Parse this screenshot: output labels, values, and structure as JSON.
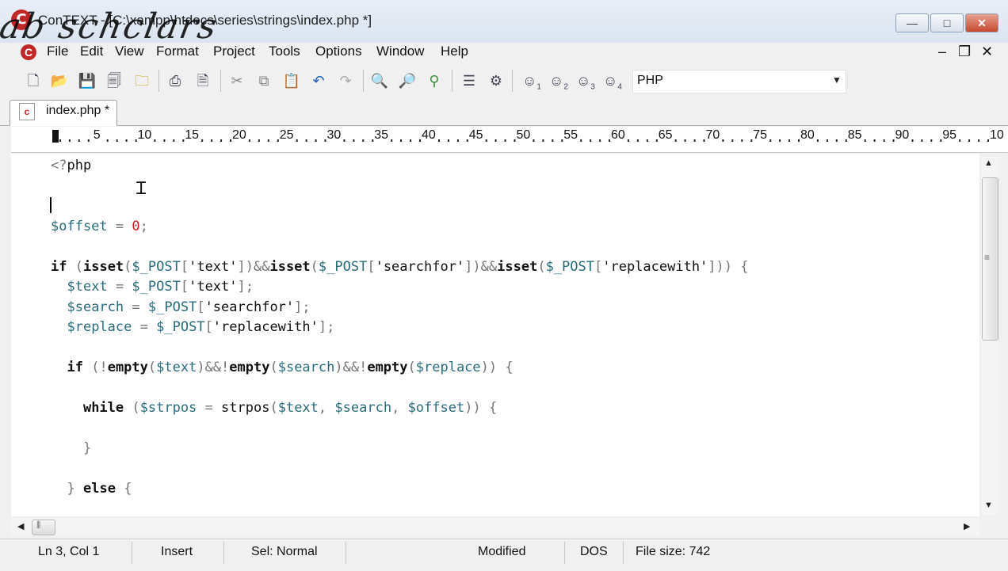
{
  "window": {
    "title": "ConTEXT - [C:\\xampp\\htdocs\\series\\strings\\index.php *]",
    "watermark": "ab schclars",
    "logo_letter": "C",
    "controls": {
      "minimize": "—",
      "maximize": "□",
      "close": "✕"
    }
  },
  "menu": {
    "items": [
      "File",
      "Edit",
      "View",
      "Format",
      "Project",
      "Tools",
      "Options",
      "Window",
      "Help"
    ],
    "mdi_controls": {
      "minimize": "–",
      "restore": "❐",
      "close": "✕"
    }
  },
  "toolbar": {
    "icons": [
      "new-file-icon",
      "open-folder-icon",
      "save-icon",
      "save-all-icon",
      "open-project-icon",
      "print-icon",
      "print-preview-icon",
      "cut-icon",
      "copy-icon",
      "paste-icon",
      "undo-icon",
      "redo-icon",
      "find-icon",
      "find-next-icon",
      "replace-icon",
      "properties-icon",
      "settings-icon",
      "user-1-icon",
      "user-2-icon",
      "user-3-icon",
      "user-4-icon"
    ],
    "language_select": {
      "value": "PHP"
    }
  },
  "tab": {
    "label": "index.php *",
    "icon": "c"
  },
  "ruler": {
    "marks": [
      "5",
      "10",
      "15",
      "20",
      "25",
      "30",
      "35",
      "40",
      "45",
      "50",
      "55",
      "60",
      "65",
      "70",
      "75",
      "80",
      "85",
      "90",
      "95",
      "10"
    ]
  },
  "editor": {
    "lines": [
      "<?php",
      "",
      "",
      "$offset = 0;",
      "",
      "if (isset($_POST['text'])&&isset($_POST['searchfor'])&&isset($_POST['replacewith'])) {",
      "  $text = $_POST['text'];",
      "  $search = $_POST['searchfor'];",
      "  $replace = $_POST['replacewith'];",
      "",
      "  if (!empty($text)&&!empty($search)&&!empty($replace)) {",
      "",
      "    while ($strpos = strpos($text, $search, $offset)) {",
      "",
      "    }",
      "",
      "  } else {"
    ]
  },
  "status": {
    "position": "Ln 3, Col 1",
    "mode": "Insert",
    "selection": "Sel: Normal",
    "modified": "Modified",
    "line_ending": "DOS",
    "file_size": "File size: 742"
  },
  "colors": {
    "keyword": "#111111",
    "variable": "#2a6b7a",
    "number": "#c02020",
    "operator": "#777777"
  }
}
